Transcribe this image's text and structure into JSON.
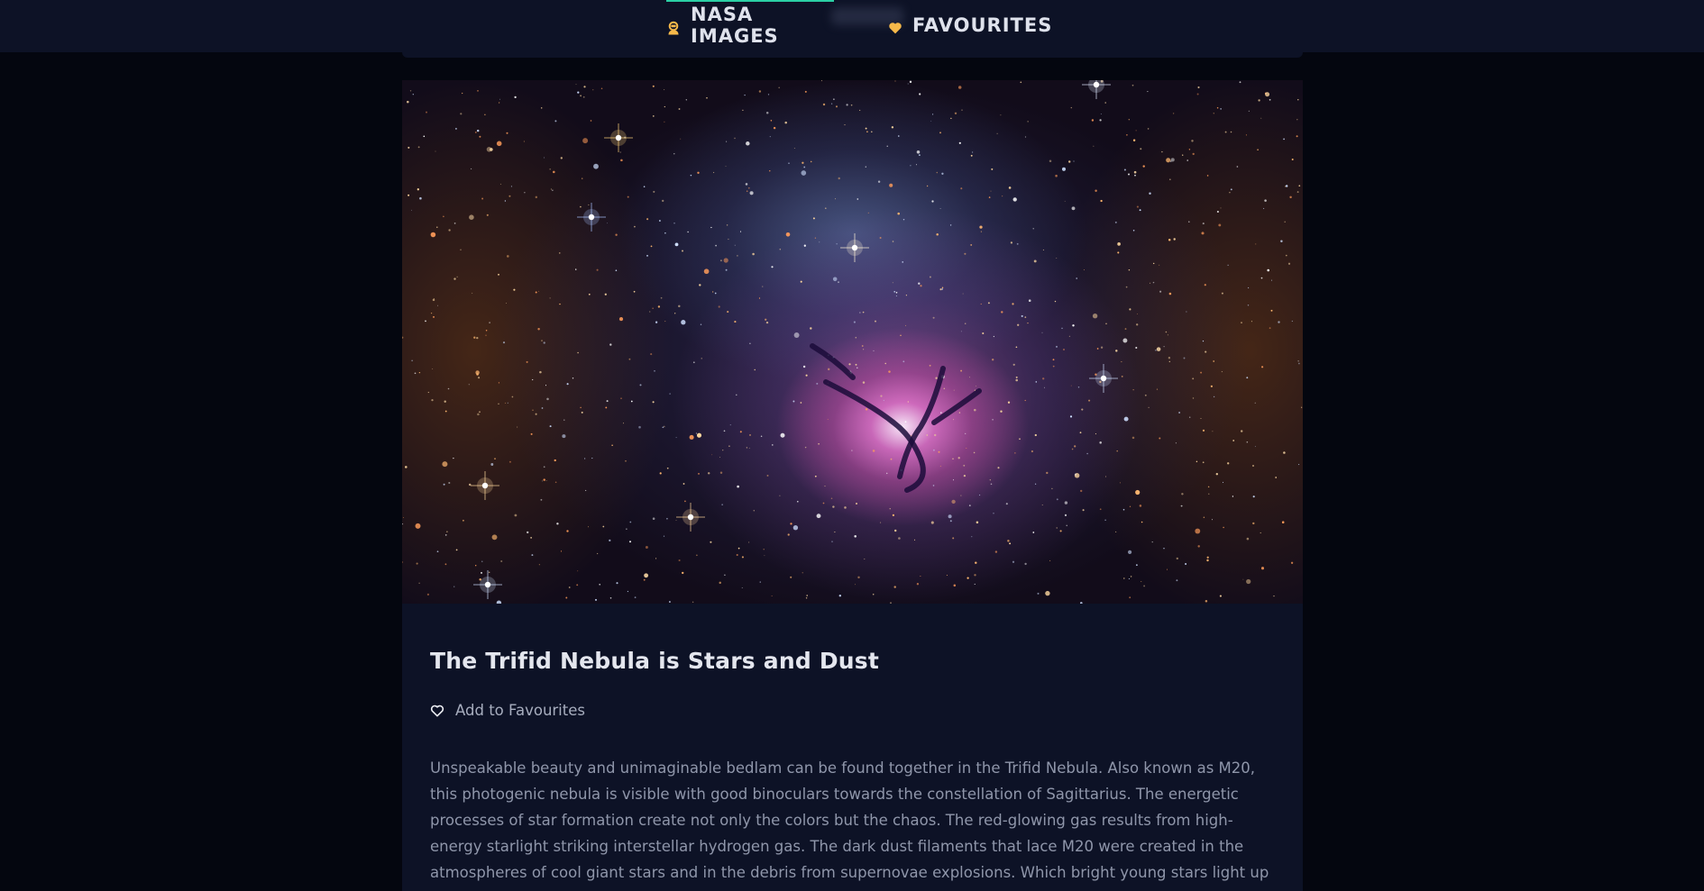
{
  "nav": {
    "items": [
      {
        "label": "NASA IMAGES",
        "icon": "astronaut-icon",
        "active": true
      },
      {
        "label": "FAVOURITES",
        "icon": "heart-icon",
        "active": false
      }
    ]
  },
  "article": {
    "title": "The Trifid Nebula is Stars and Dust",
    "favourite_action": "Add to Favourites",
    "description": "Unspeakable beauty and unimaginable bedlam can be found together in the Trifid Nebula. Also known as M20, this photogenic nebula is visible with good binoculars towards the constellation of Sagittarius. The energetic processes of star formation create not only the colors but the chaos. The red-glowing gas results from high-energy starlight striking interstellar hydrogen gas. The dark dust filaments that lace M20 were created in the atmospheres of cool giant stars and in the debris from supernovae explosions. Which bright young stars light up the blue reflection nebula is still being"
  },
  "colors": {
    "accent": "#2bd0a5",
    "icon": "#f6b94a",
    "background": "#04060f",
    "surface": "#0d1226"
  }
}
